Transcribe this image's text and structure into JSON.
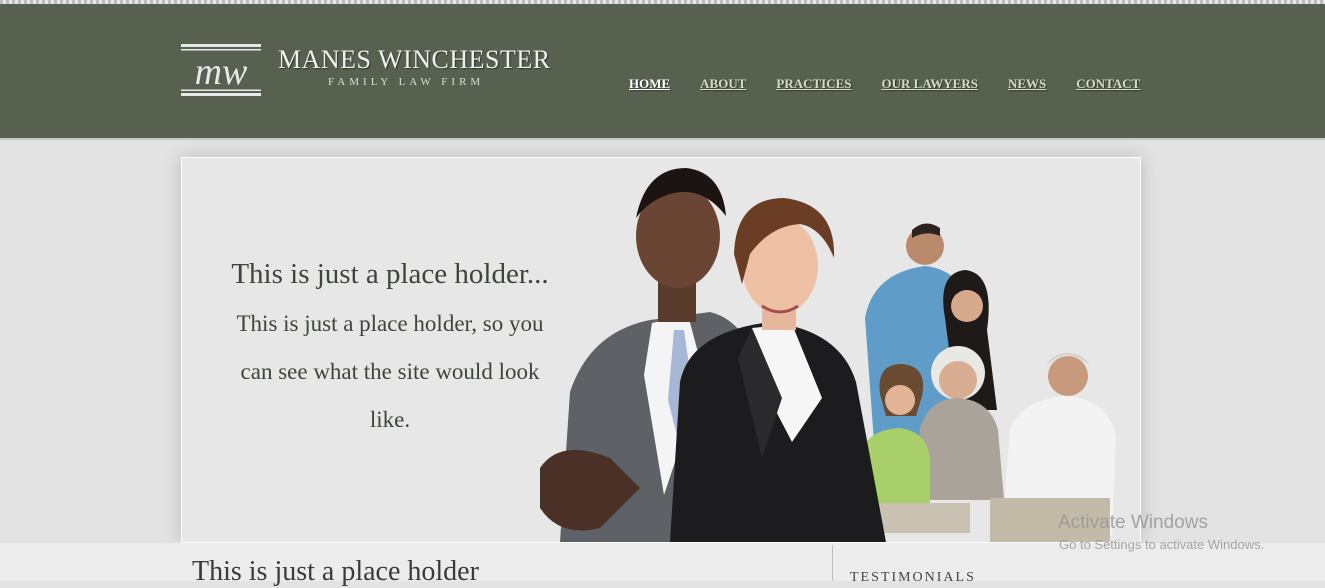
{
  "brand": {
    "title": "MANES WINCHESTER",
    "subtitle": "FAMILY LAW FIRM",
    "logo_text": "mw"
  },
  "nav": {
    "items": [
      {
        "label": "HOME",
        "active": true
      },
      {
        "label": "ABOUT",
        "active": false
      },
      {
        "label": "PRACTICES",
        "active": false
      },
      {
        "label": "OUR LAWYERS",
        "active": false
      },
      {
        "label": "NEWS",
        "active": false
      },
      {
        "label": "CONTACT",
        "active": false
      }
    ]
  },
  "hero": {
    "heading": "This is just a place holder...",
    "body": "This is just a place holder, so you can see what the site would look like.",
    "image_icon": "people-photo-icon"
  },
  "content": {
    "heading": "This is just a place holder",
    "sidebar_heading": "TESTIMONIALS"
  },
  "watermark": {
    "line1": "Activate Windows",
    "line2": "Go to Settings to activate Windows."
  },
  "colors": {
    "header_bg": "#58614f",
    "page_bg": "#e3e3e3",
    "nav_text": "#d4d9c8",
    "hero_text": "#3f4438"
  }
}
